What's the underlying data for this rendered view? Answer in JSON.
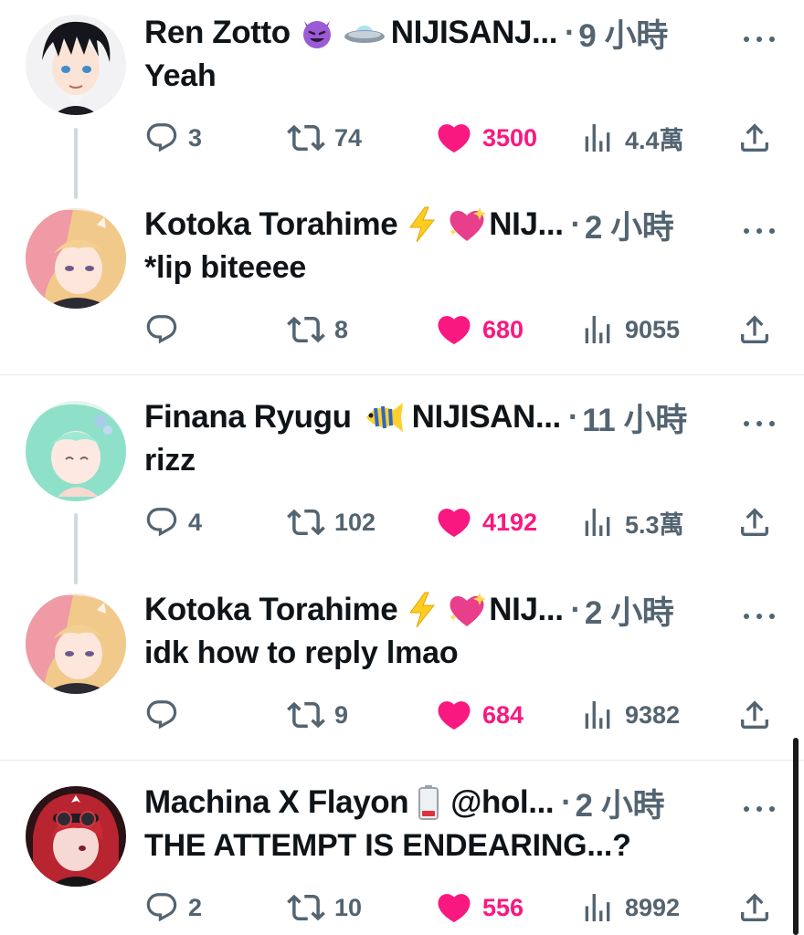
{
  "colors": {
    "text": "#0f1419",
    "muted": "#536471",
    "like": "#f91880",
    "thread_line": "#cfd9de",
    "divider": "#e1e8ed"
  },
  "posts": [
    {
      "name": "Ren Zotto",
      "emojis": [
        "smiling-devil-emoji",
        "flying-saucer-emoji"
      ],
      "handle": "NIJISANJ...",
      "dot": "·",
      "time": "9 小時",
      "text": "Yeah",
      "avatar": "ren-zotto-avatar",
      "replies": "3",
      "reposts": "74",
      "likes": "3500",
      "views": "4.4萬"
    },
    {
      "name": "Kotoka Torahime",
      "emojis": [
        "lightning-emoji",
        "sparkling-heart-emoji"
      ],
      "handle": "NIJ...",
      "dot": "·",
      "time": "2 小時",
      "text": "*lip biteeee",
      "avatar": "kotoka-torahime-avatar",
      "replies": "",
      "reposts": "8",
      "likes": "680",
      "views": "9055"
    },
    {
      "name": "Finana Ryugu",
      "emojis": [
        "tropical-fish-emoji"
      ],
      "handle": "NIJISAN...",
      "dot": "·",
      "time": "11 小時",
      "text": "rizz",
      "avatar": "finana-ryugu-avatar",
      "replies": "4",
      "reposts": "102",
      "likes": "4192",
      "views": "5.3萬"
    },
    {
      "name": "Kotoka Torahime",
      "emojis": [
        "lightning-emoji",
        "sparkling-heart-emoji"
      ],
      "handle": "NIJ...",
      "dot": "·",
      "time": "2 小時",
      "text": "idk how to reply lmao",
      "avatar": "kotoka-torahime-avatar",
      "replies": "",
      "reposts": "9",
      "likes": "684",
      "views": "9382"
    },
    {
      "name": "Machina X Flayon",
      "emojis": [
        "low-battery-emoji"
      ],
      "handle": "@hol...",
      "dot": "·",
      "time": "2 小時",
      "text": "THE ATTEMPT IS ENDEARING...?",
      "avatar": "machina-x-flayon-avatar",
      "replies": "2",
      "reposts": "10",
      "likes": "556",
      "views": "8992"
    }
  ]
}
